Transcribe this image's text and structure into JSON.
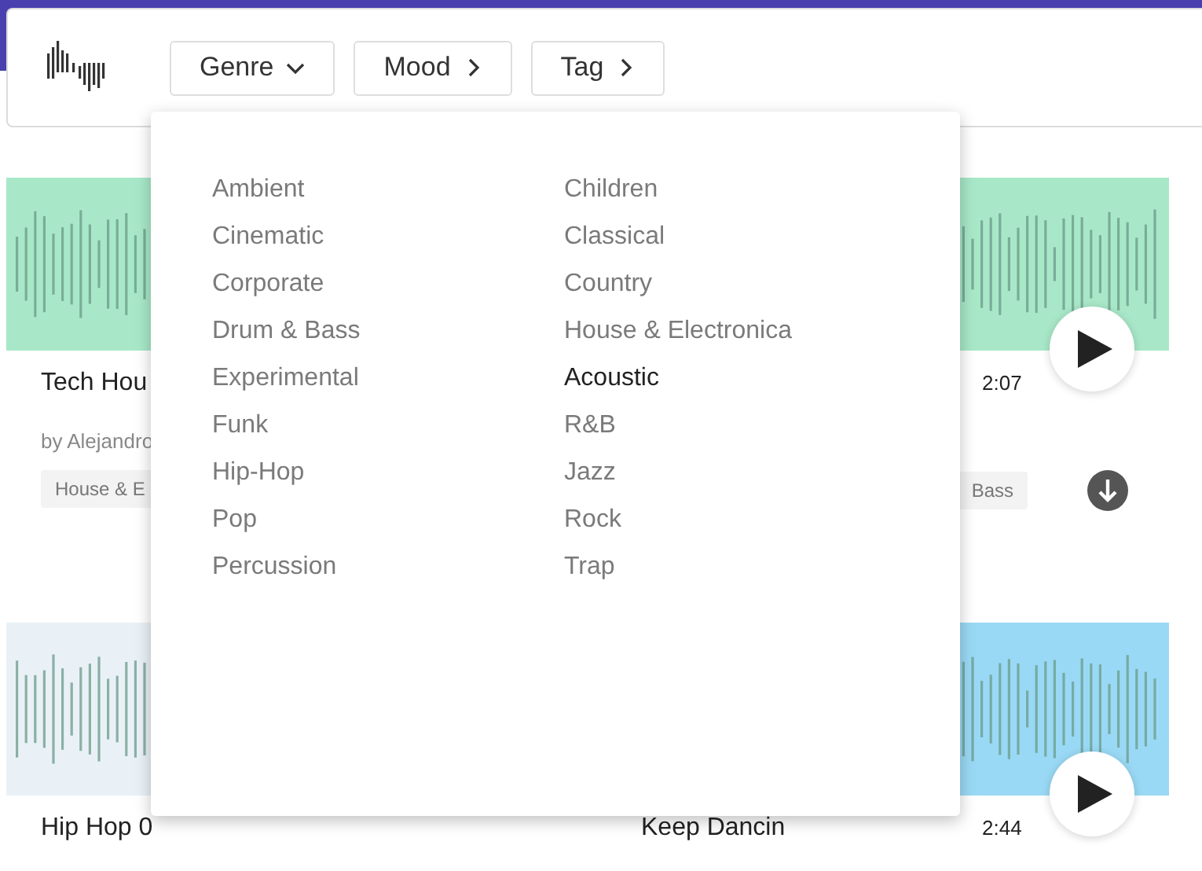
{
  "filters": [
    {
      "label": "Genre",
      "expanded": true
    },
    {
      "label": "Mood",
      "expanded": false
    },
    {
      "label": "Tag",
      "expanded": false
    }
  ],
  "genre_menu": {
    "columns": [
      [
        {
          "label": "Ambient",
          "selected": false
        },
        {
          "label": "Cinematic",
          "selected": false
        },
        {
          "label": "Corporate",
          "selected": false
        },
        {
          "label": "Drum & Bass",
          "selected": false
        },
        {
          "label": "Experimental",
          "selected": false
        },
        {
          "label": "Funk",
          "selected": false
        },
        {
          "label": "Hip-Hop",
          "selected": false
        },
        {
          "label": "Pop",
          "selected": false
        },
        {
          "label": "Percussion",
          "selected": false
        }
      ],
      [
        {
          "label": "Children",
          "selected": false
        },
        {
          "label": "Classical",
          "selected": false
        },
        {
          "label": "Country",
          "selected": false
        },
        {
          "label": "House & Electronica",
          "selected": false
        },
        {
          "label": "Acoustic",
          "selected": true
        },
        {
          "label": "R&B",
          "selected": false
        },
        {
          "label": "Jazz",
          "selected": false
        },
        {
          "label": "Rock",
          "selected": false
        },
        {
          "label": "Trap",
          "selected": false
        }
      ]
    ]
  },
  "tracks": [
    {
      "title": "Tech Hou",
      "artist": "by Alejandro",
      "tags": [
        "House & E"
      ],
      "color": "#a8e8c8"
    },
    {
      "duration": "2:07",
      "tags": [
        "Bass"
      ],
      "color": "#a8e8c8",
      "play_button": true,
      "download": true
    },
    {
      "title": "Hip Hop 0",
      "color": "#e9f1f7"
    },
    {
      "title": "Keep Dancin",
      "duration": "2:44",
      "color": "#9ad9f5",
      "play_button": true
    }
  ]
}
